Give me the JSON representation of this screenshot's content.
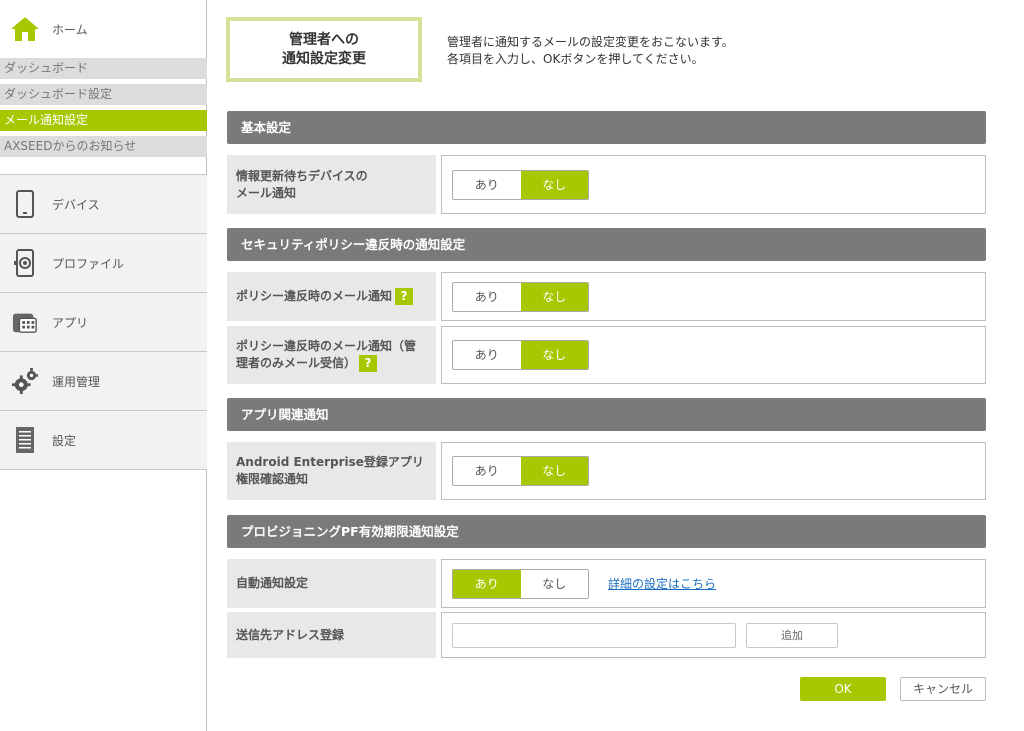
{
  "sidebar": {
    "home_label": "ホーム",
    "sub_items": [
      {
        "label": "ダッシュボード",
        "active": false
      },
      {
        "label": "ダッシュボード設定",
        "active": false
      },
      {
        "label": "メール通知設定",
        "active": true
      },
      {
        "label": "AXSEEDからのお知らせ",
        "active": false
      }
    ],
    "main_items": [
      {
        "label": "デバイス",
        "icon": "device-icon"
      },
      {
        "label": "プロファイル",
        "icon": "profile-icon"
      },
      {
        "label": "アプリ",
        "icon": "app-icon"
      },
      {
        "label": "運用管理",
        "icon": "gear-icon"
      },
      {
        "label": "設定",
        "icon": "settings-doc-icon"
      }
    ]
  },
  "header": {
    "title_line1": "管理者への",
    "title_line2": "通知設定変更",
    "desc_line1": "管理者に通知するメールの設定変更をおこないます。",
    "desc_line2": "各項目を入力し、OKボタンを押してください。"
  },
  "sections": {
    "basic": "基本設定",
    "security": "セキュリティポリシー違反時の通知設定",
    "app": "アプリ関連通知",
    "provisioning": "プロビジョニングPF有効期限通知設定"
  },
  "rows": {
    "device_update": {
      "label_line1": "情報更新待ちデバイスの",
      "label_line2": "メール通知",
      "on": "あり",
      "off": "なし",
      "selected": "なし"
    },
    "policy_violation": {
      "label": "ポリシー違反時のメール通知",
      "help": "?",
      "on": "あり",
      "off": "なし",
      "selected": "なし"
    },
    "policy_violation_admin": {
      "label_line1": "ポリシー違反時のメール通知（管",
      "label_line2": "理者のみメール受信）",
      "help": "?",
      "on": "あり",
      "off": "なし",
      "selected": "なし"
    },
    "android_enterprise": {
      "label_line1": "Android Enterprise登録アプリ",
      "label_line2": "権限確認通知",
      "on": "あり",
      "off": "なし",
      "selected": "なし"
    },
    "auto_notify": {
      "label": "自動通知設定",
      "on": "あり",
      "off": "なし",
      "selected": "あり",
      "link": "詳細の設定はこちら"
    },
    "recipient": {
      "label": "送信先アドレス登録",
      "value": "",
      "placeholder": "",
      "add_label": "追加"
    }
  },
  "footer": {
    "ok_label": "OK",
    "cancel_label": "キャンセル"
  },
  "colors": {
    "accent": "#a9c700",
    "section_bg": "#7a7a7a",
    "link": "#1a6fc4",
    "title_border": "#d3e49a"
  }
}
